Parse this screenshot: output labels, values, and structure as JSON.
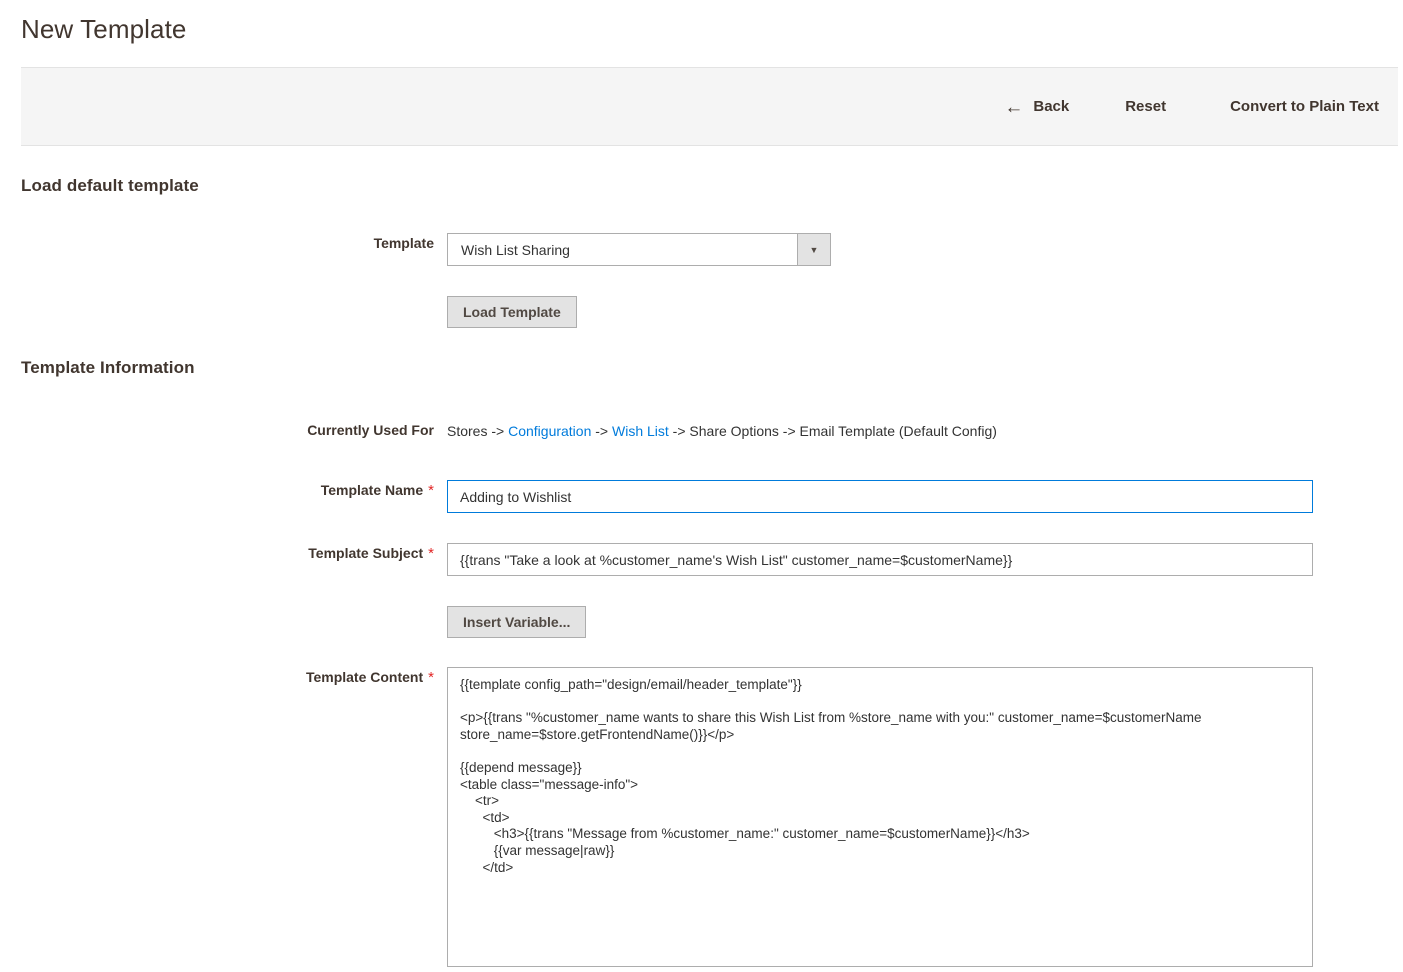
{
  "page": {
    "title": "New Template"
  },
  "toolbar": {
    "back_label": "Back",
    "back_icon": "arrow-left-icon",
    "back_arrow_glyph": "←",
    "reset_label": "Reset",
    "convert_label": "Convert to Plain Text"
  },
  "load_default_section": {
    "heading": "Load default template",
    "template_label": "Template",
    "template_selected": "Wish List Sharing",
    "dropdown_arrow_glyph": "▼",
    "load_button_label": "Load Template"
  },
  "template_information": {
    "heading": "Template Information",
    "currently_used_for": {
      "label": "Currently Used For",
      "parts": [
        {
          "text": "Stores",
          "link": false
        },
        {
          "text": " -> ",
          "link": false
        },
        {
          "text": "Configuration",
          "link": true
        },
        {
          "text": " -> ",
          "link": false
        },
        {
          "text": "Wish List",
          "link": true
        },
        {
          "text": " -> ",
          "link": false
        },
        {
          "text": "Share Options -> Email Template  (Default Config)",
          "link": false
        }
      ],
      "full_text": "Stores -> Configuration -> Wish List -> Share Options -> Email Template  (Default Config)"
    },
    "template_name": {
      "label": "Template Name",
      "required_marker": "*",
      "value": "Adding to Wishlist"
    },
    "template_subject": {
      "label": "Template Subject",
      "required_marker": "*",
      "value": "{{trans \"Take a look at %customer_name's Wish List\" customer_name=$customerName}}"
    },
    "insert_variable_button": "Insert Variable...",
    "template_content": {
      "label": "Template Content",
      "required_marker": "*",
      "value": "{{template config_path=\"design/email/header_template\"}}\n\n<p>{{trans \"%customer_name wants to share this Wish List from %store_name with you:\" customer_name=$customerName\nstore_name=$store.getFrontendName()}}</p>\n\n{{depend message}}\n<table class=\"message-info\">\n    <tr>\n      <td>\n         <h3>{{trans \"Message from %customer_name:\" customer_name=$customerName}}</h3>\n         {{var message|raw}}\n      </td>"
    }
  },
  "colors": {
    "accent_link": "#007bdb",
    "required_asterisk": "#e22626",
    "heading": "#41362f",
    "toolbar_bg": "#f5f5f5",
    "button_bg": "#e3e3e3",
    "border": "#adadad",
    "focus_border": "#007bdb"
  }
}
